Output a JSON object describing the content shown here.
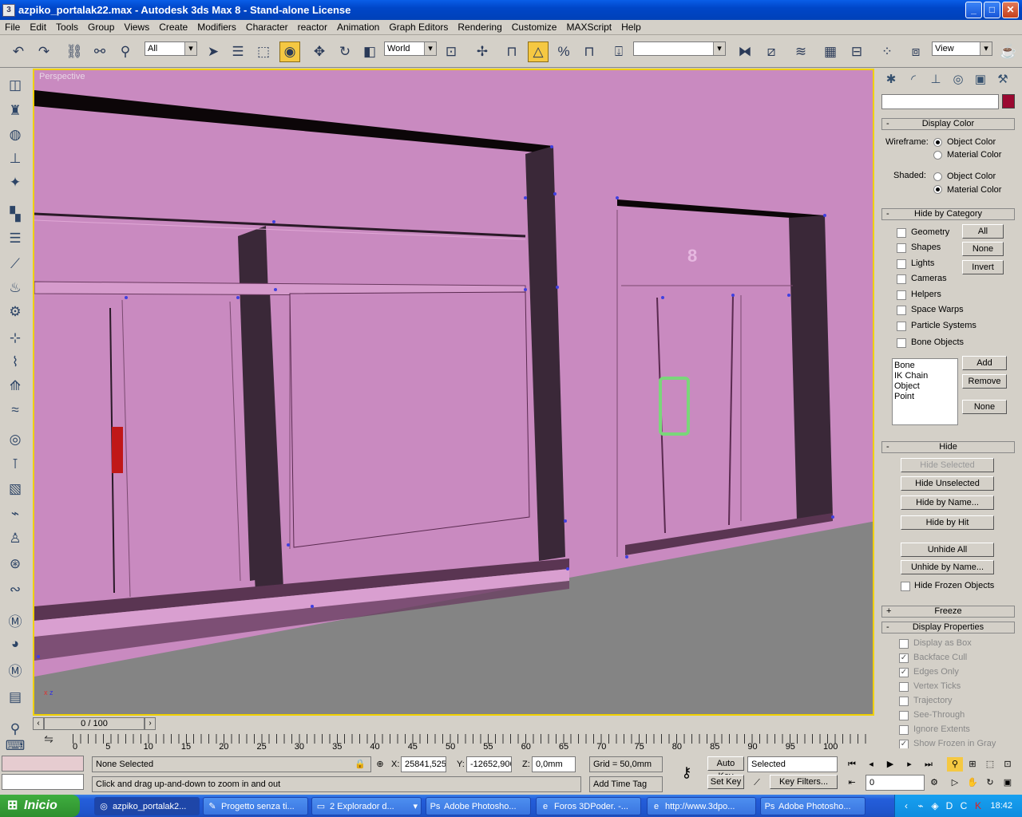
{
  "window": {
    "title": "azpiko_portalak22.max - Autodesk 3ds Max 8  - Stand-alone License",
    "minimize": "_",
    "maximize": "□",
    "close": "✕"
  },
  "menu": [
    "File",
    "Edit",
    "Tools",
    "Group",
    "Views",
    "Create",
    "Modifiers",
    "Character",
    "reactor",
    "Animation",
    "Graph Editors",
    "Rendering",
    "Customize",
    "MAXScript",
    "Help"
  ],
  "toolbar": {
    "selection_filter": "All",
    "ref_coord": "World",
    "named_selection": "",
    "render_view": "View",
    "snap_label": "2"
  },
  "viewport": {
    "label": "Perspective",
    "number_8": "8",
    "axis_x": "x",
    "axis_z": "z"
  },
  "colors": {
    "object_pink": "#c98ac0",
    "ground": "#848484",
    "dark_wall": "#3a2838",
    "vertex": "#4040e0",
    "handle_red": "#c01818",
    "handle_green": "#7ad67a",
    "object_color_swatch": "#9a0830"
  },
  "command_panel": {
    "display_color": {
      "title": "Display Color",
      "wireframe_label": "Wireframe:",
      "shaded_label": "Shaded:",
      "object_color": "Object Color",
      "material_color": "Material Color"
    },
    "hide_by_category": {
      "title": "Hide by Category",
      "items": [
        "Geometry",
        "Shapes",
        "Lights",
        "Cameras",
        "Helpers",
        "Space Warps",
        "Particle Systems",
        "Bone Objects"
      ],
      "all": "All",
      "none": "None",
      "invert": "Invert",
      "list": [
        "Bone",
        "IK Chain Object",
        "Point"
      ],
      "add": "Add",
      "remove": "Remove",
      "none2": "None"
    },
    "hide": {
      "title": "Hide",
      "hide_selected": "Hide Selected",
      "hide_unselected": "Hide Unselected",
      "hide_by_name": "Hide by Name...",
      "hide_by_hit": "Hide by Hit",
      "unhide_all": "Unhide All",
      "unhide_by_name": "Unhide by Name...",
      "hide_frozen": "Hide Frozen Objects"
    },
    "freeze": {
      "title": "Freeze",
      "sign": "+"
    },
    "display_properties": {
      "title": "Display Properties",
      "items": [
        {
          "label": "Display as Box",
          "checked": false
        },
        {
          "label": "Backface Cull",
          "checked": true
        },
        {
          "label": "Edges Only",
          "checked": true
        },
        {
          "label": "Vertex Ticks",
          "checked": false
        },
        {
          "label": "Trajectory",
          "checked": false
        },
        {
          "label": "See-Through",
          "checked": false
        },
        {
          "label": "Ignore Extents",
          "checked": false
        },
        {
          "label": "Show Frozen in Gray",
          "checked": true
        }
      ]
    }
  },
  "timeline": {
    "slider": "0 / 100",
    "ticks": [
      "0",
      "5",
      "10",
      "15",
      "20",
      "25",
      "30",
      "35",
      "40",
      "45",
      "50",
      "55",
      "60",
      "65",
      "70",
      "75",
      "80",
      "85",
      "90",
      "95",
      "100"
    ]
  },
  "status": {
    "selection": "None Selected",
    "prompt": "Click and drag up-and-down to zoom in and out",
    "x_label": "X:",
    "x": "25841,525",
    "y_label": "Y:",
    "y": "-12652,906",
    "z_label": "Z:",
    "z": "0,0mm",
    "grid": "Grid = 50,0mm",
    "add_time_tag": "Add Time Tag",
    "auto_key": "Auto Key",
    "set_key": "Set Key",
    "key_mode": "Selected",
    "key_filters": "Key Filters...",
    "frame": "0"
  },
  "taskbar": {
    "start": "Inicio",
    "tasks": [
      "azpiko_portalak2...",
      "Progetto senza ti...",
      "2 Explorador d...",
      "Adobe Photosho...",
      "Foros 3DPoder. -...",
      "http://www.3dpo...",
      "Adobe Photosho..."
    ],
    "clock": "18:42"
  }
}
